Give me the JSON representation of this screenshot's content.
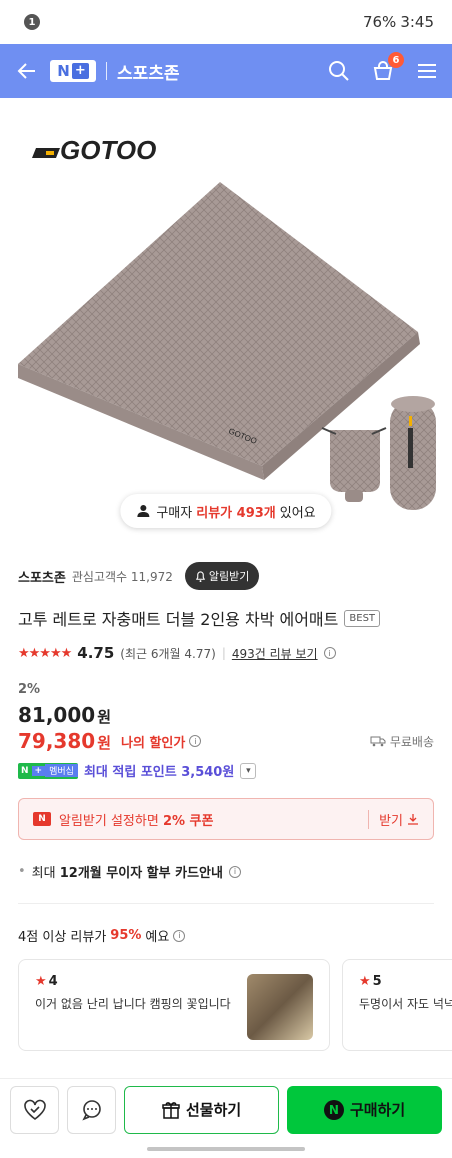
{
  "status_bar": {
    "notification_count": "1",
    "battery": "76%",
    "time": "3:45"
  },
  "header": {
    "logo_n": "N",
    "logo_plus": "+",
    "store_name": "스포츠존",
    "cart_count": "6"
  },
  "product_image": {
    "brand_logo": "GOTOO",
    "review_prompt_prefix": "구매자",
    "review_prompt_highlight": "리뷰가 493개",
    "review_prompt_suffix": "있어요"
  },
  "seller": {
    "name": "스포츠존",
    "fans_label": "관심고객수 11,972",
    "alarm_button": "알림받기"
  },
  "product": {
    "title": "고투 레트로 자충매트 더블 2인용 차박 에어매트",
    "badge": "BEST"
  },
  "rating": {
    "stars": "★★★★★",
    "score": "4.75",
    "recent": "(최근 6개월 4.77)",
    "review_link": "493건 리뷰 보기"
  },
  "price": {
    "discount": "2%",
    "original": "81,000",
    "currency": "원",
    "my_price": "79,380",
    "my_price_label": "나의 할인가",
    "shipping": "무료배송"
  },
  "membership": {
    "n": "N",
    "plus": "+",
    "tag": "멤버십",
    "text": "최대 적립 포인트 3,540원"
  },
  "coupon": {
    "icon": "N",
    "text_prefix": "알림받기 설정하면 ",
    "text_bold": "2% 쿠폰",
    "get_label": "받기"
  },
  "card_info": {
    "prefix": "최대 ",
    "bold": "12개월 무이자 할부 카드안내"
  },
  "review_summary": {
    "prefix": "4점 이상 리뷰가 ",
    "percent": "95%",
    "suffix": " 예요"
  },
  "reviews": [
    {
      "score": "4",
      "text": "이거 없음 난리 납니다 캠핑의 꽃입니다"
    },
    {
      "score": "5",
      "text": "두명이서 자도 넉넉 가끔 가족들과 거실"
    }
  ],
  "bottom_bar": {
    "gift_label": "선물하기",
    "buy_icon": "N",
    "buy_label": "구매하기"
  }
}
